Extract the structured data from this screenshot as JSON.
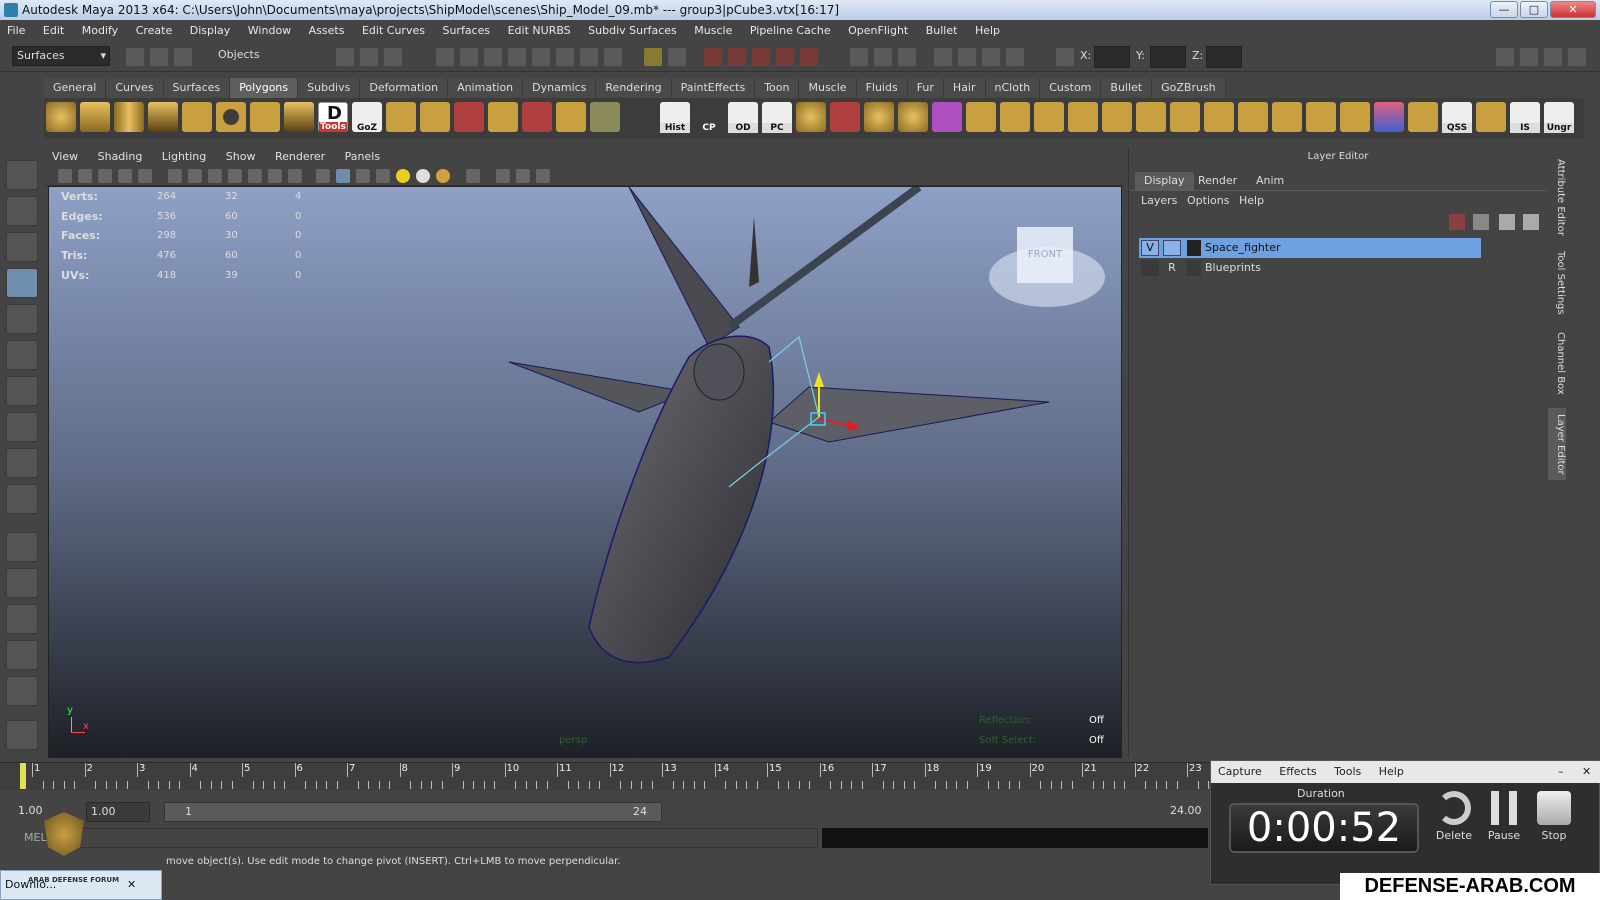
{
  "window": {
    "title": "Autodesk Maya 2013 x64: C:\\Users\\John\\Documents\\maya\\projects\\ShipModel\\scenes\\Ship_Model_09.mb*   ---   group3|pCube3.vtx[16:17]",
    "minimize": "—",
    "maximize": "□",
    "close": "✕"
  },
  "menus": [
    "File",
    "Edit",
    "Modify",
    "Create",
    "Display",
    "Window",
    "Assets",
    "Edit Curves",
    "Surfaces",
    "Edit NURBS",
    "Subdiv Surfaces",
    "Muscle",
    "Pipeline Cache",
    "OpenFlight",
    "Bullet",
    "Help"
  ],
  "status": {
    "menuset": "Surfaces",
    "selmode": "Objects",
    "x_label": "X:",
    "y_label": "Y:",
    "z_label": "Z:"
  },
  "shelf_tabs": [
    "General",
    "Curves",
    "Surfaces",
    "Polygons",
    "Subdivs",
    "Deformation",
    "Animation",
    "Dynamics",
    "Rendering",
    "PaintEffects",
    "Toon",
    "Muscle",
    "Fluids",
    "Fur",
    "Hair",
    "nCloth",
    "Custom",
    "Bullet",
    "GoZBrush"
  ],
  "shelf_active": "Polygons",
  "shelf_labels": {
    "dtools": "D",
    "tools": "Tools",
    "goz": "GoZ",
    "hist": "Hist",
    "cp": "CP",
    "od": "OD",
    "pc": "PC",
    "qss": "QSS",
    "is": "IS",
    "ungr": "Ungr"
  },
  "viewport": {
    "menus": [
      "View",
      "Shading",
      "Lighting",
      "Show",
      "Renderer",
      "Panels"
    ],
    "hud": [
      {
        "label": "Verts:",
        "a": "264",
        "b": "32",
        "c": "4"
      },
      {
        "label": "Edges:",
        "a": "536",
        "b": "60",
        "c": "0"
      },
      {
        "label": "Faces:",
        "a": "298",
        "b": "30",
        "c": "0"
      },
      {
        "label": "Tris:",
        "a": "476",
        "b": "60",
        "c": "0"
      },
      {
        "label": "UVs:",
        "a": "418",
        "b": "39",
        "c": "0"
      }
    ],
    "camera": "persp",
    "viewcube": "FRONT",
    "reflection_label": "Reflection:",
    "reflection_value": "Off",
    "softselect_label": "Soft Select:",
    "softselect_value": "Off",
    "axis_y": "y",
    "axis_x": "x"
  },
  "layer_editor": {
    "title": "Layer Editor",
    "tabs": [
      "Display",
      "Render",
      "Anim"
    ],
    "active_tab": "Display",
    "menus": [
      "Layers",
      "Options",
      "Help"
    ],
    "layers": [
      {
        "v": "V",
        "p": "",
        "name": "Space_fighter",
        "selected": true
      },
      {
        "v": "",
        "p": "R",
        "name": "Blueprints",
        "selected": false
      }
    ]
  },
  "side_tabs": [
    "Attribute Editor",
    "Tool Settings",
    "Channel Box",
    "Layer Editor"
  ],
  "timeline": {
    "ticks": [
      "1",
      "2",
      "3",
      "4",
      "5",
      "6",
      "7",
      "8",
      "9",
      "10",
      "11",
      "12",
      "13",
      "14",
      "15",
      "16",
      "17",
      "18",
      "19",
      "20",
      "21",
      "22",
      "23"
    ]
  },
  "range": {
    "start": "1.00",
    "start2": "1.00",
    "slider_start": "1",
    "slider_end": "24",
    "end": "24.00"
  },
  "cmdline": {
    "label": "MEL"
  },
  "help_line": "move object(s). Use edit mode to change pivot (INSERT).  Ctrl+LMB to move perpendicular.",
  "download": {
    "label": "Downlo...",
    "logo_text": "ARAB DEFENSE FORUM",
    "close": "✕"
  },
  "capture": {
    "menus": [
      "Capture",
      "Effects",
      "Tools",
      "Help"
    ],
    "min": "–",
    "close": "✕",
    "duration_label": "Duration",
    "duration": "0:00:52",
    "buttons": [
      "Delete",
      "Pause",
      "Stop"
    ]
  },
  "watermark": "DEFENSE-ARAB.COM",
  "colors": {
    "accent": "#6f8dad",
    "layer_selected": "#6fa0e0",
    "timeline_current": "#e0e050"
  }
}
